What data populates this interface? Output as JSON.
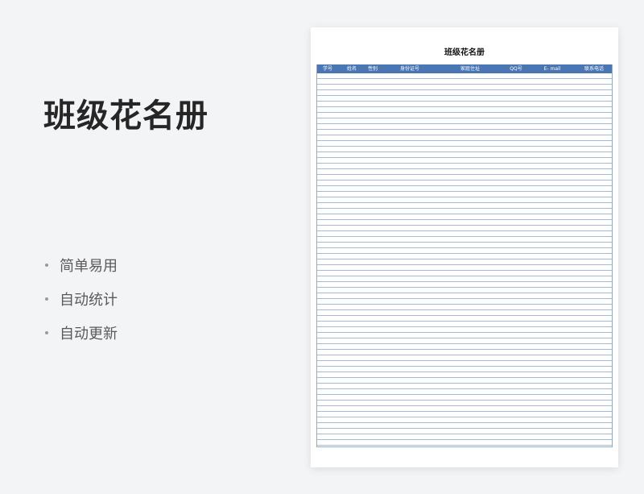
{
  "hero": {
    "title": "班级花名册"
  },
  "features": [
    {
      "label": "简单易用"
    },
    {
      "label": "自动统计"
    },
    {
      "label": "自动更新"
    }
  ],
  "sheet": {
    "title": "班级花名册",
    "columns": [
      "学号",
      "姓名",
      "性别",
      "身份证号",
      "家庭住址",
      "QQ号",
      "E- mail",
      "联系电话"
    ],
    "empty_row_count": 66
  },
  "colors": {
    "background": "#f3f4f6",
    "header_blue": "#4a77b4",
    "row_line": "#a8bbd6"
  }
}
